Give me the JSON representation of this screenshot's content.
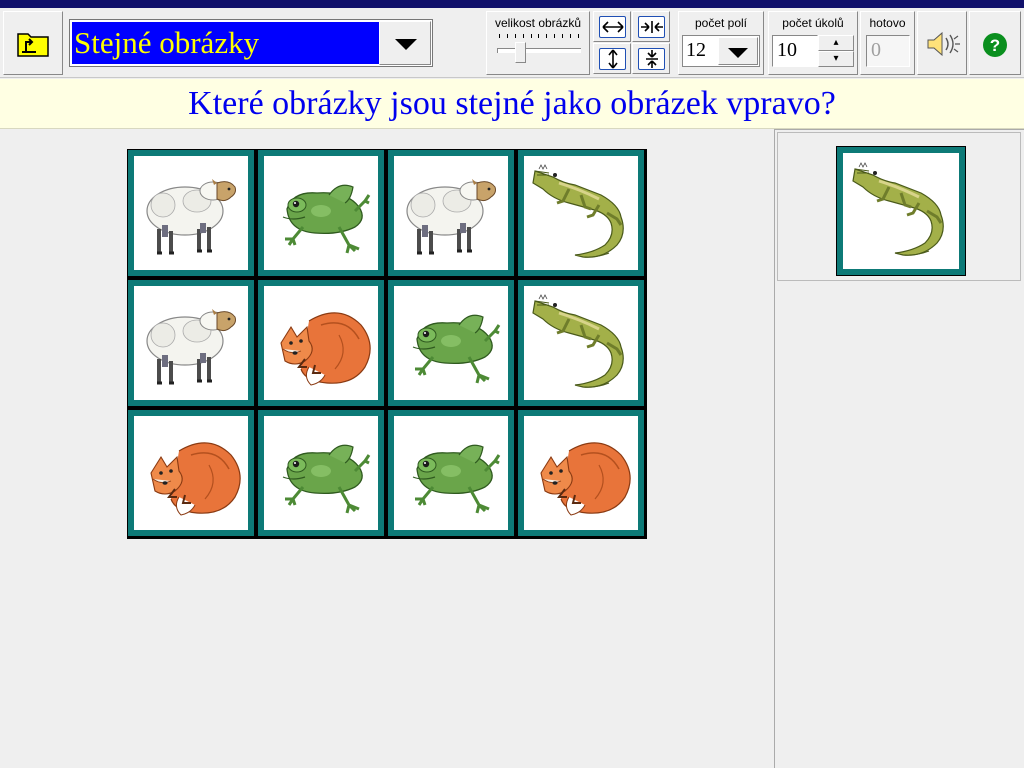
{
  "toolbar": {
    "game_name": "Stejné obrázky",
    "image_size_label": "velikost obrázků",
    "image_size_level": 0.25,
    "fields_label": "počet polí",
    "fields_value": "12",
    "tasks_label": "počet úkolů",
    "tasks_value": "10",
    "done_label": "hotovo",
    "done_value": "0",
    "icons": [
      "folder-up-icon",
      "widen-icon",
      "narrow-icon",
      "taller-icon",
      "shorter-icon",
      "speaker-icon",
      "help-icon"
    ]
  },
  "prompt": "Které obrázky jsou stejné jako obrázek vpravo?",
  "board": {
    "rows": 3,
    "cols": 4,
    "cells": [
      "sheep",
      "frog",
      "sheep",
      "crocodile",
      "sheep",
      "fox",
      "frog",
      "crocodile",
      "fox",
      "frog",
      "frog",
      "fox"
    ]
  },
  "target": "crocodile",
  "colors": {
    "title_bg": "#0000ff",
    "title_text": "#ffff00",
    "prompt_text": "#0000ee",
    "prompt_bg": "#ffffe3",
    "card_frame": "#0d7a77"
  }
}
